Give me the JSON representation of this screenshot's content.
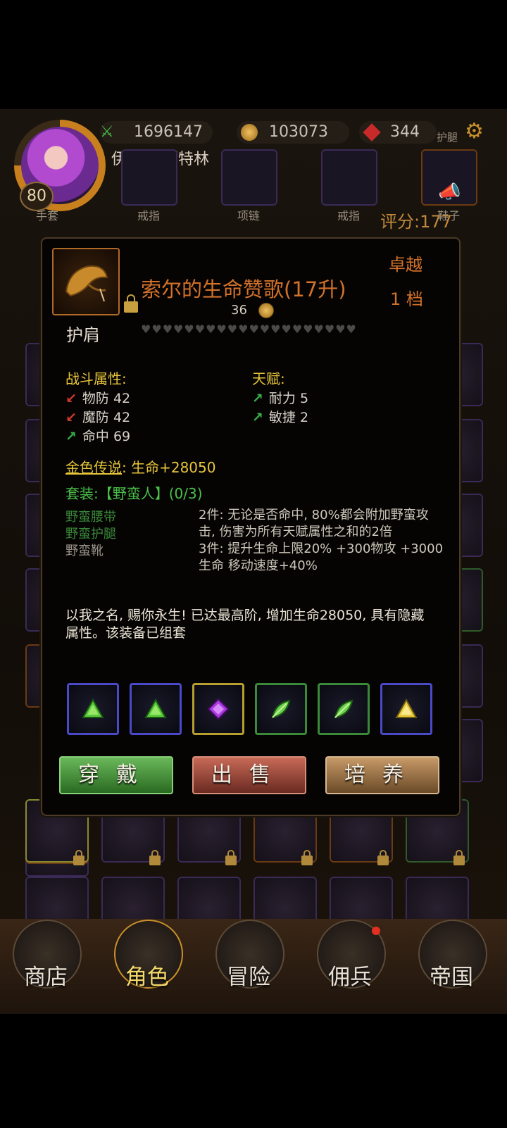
{
  "header": {
    "level": "80",
    "player_name": "伊诺克·斯特林",
    "power": "1696147",
    "gold": "103073",
    "gems": "344",
    "slot_label_leggings": "护腿",
    "score": "评分:177",
    "equip_labels": [
      "手套",
      "戒指",
      "项链",
      "戒指",
      "鞋子"
    ]
  },
  "item": {
    "name": "索尔的生命赞歌(17升)",
    "price": "36",
    "quality": "卓越",
    "grade": "1 档",
    "slot_type": "护肩",
    "hearts": "♥♥♥♥♥♥♥♥♥♥♥♥♥♥♥♥♥♥♥♥",
    "combat_title": "战斗属性:",
    "combat_stats": [
      {
        "label": "物防 42",
        "dir": "down"
      },
      {
        "label": "魔防 42",
        "dir": "down"
      },
      {
        "label": "命中 69",
        "dir": "up"
      }
    ],
    "talent_title": "天赋:",
    "talent_stats": [
      {
        "label": "耐力 5",
        "dir": "up"
      },
      {
        "label": "敏捷 2",
        "dir": "up"
      }
    ],
    "legend_label": "金色传说",
    "legend_value": ": 生命+28050",
    "set_title": "套装:【野蛮人】(0/3)",
    "set_pieces": [
      {
        "name": "野蛮腰带",
        "owned": true
      },
      {
        "name": "野蛮护腿",
        "owned": true
      },
      {
        "name": "野蛮靴",
        "owned": false
      }
    ],
    "set_bonus_2": "2件: 无论是否命中, 80%都会附加野蛮攻击, 伤害为所有天赋属性之和的2倍",
    "set_bonus_3": "3件: 提升生命上限20% +300物攻 +3000生命 移动速度+40%",
    "flavor": "以我之名, 赐你永生! 已达最高阶, 增加生命28050, 具有隐藏属性。该装备已组套"
  },
  "gems": [
    {
      "icon": "green-triangle-gem-icon",
      "border": "#4a4ac8",
      "color": "#5ac83a"
    },
    {
      "icon": "green-triangle-gem-icon",
      "border": "#4a4ac8",
      "color": "#5ac83a"
    },
    {
      "icon": "purple-diamond-gem-icon",
      "border": "#b8a030",
      "color": "#a83ae0"
    },
    {
      "icon": "green-leaf-gem-icon",
      "border": "#3a8a3a",
      "color": "#6ad04a"
    },
    {
      "icon": "green-leaf-gem-icon",
      "border": "#3a8a3a",
      "color": "#6ad04a"
    },
    {
      "icon": "yellow-triangle-gem-icon",
      "border": "#4a4ac8",
      "color": "#e8c83a"
    }
  ],
  "actions": {
    "equip": "穿戴",
    "sell": "出售",
    "train": "培养"
  },
  "nav": [
    "商店",
    "角色",
    "冒险",
    "佣兵",
    "帝国"
  ],
  "colors": {
    "quality_orange": "#d2712a",
    "legend_gold": "#e8c63a",
    "set_green": "#4ac04a"
  }
}
